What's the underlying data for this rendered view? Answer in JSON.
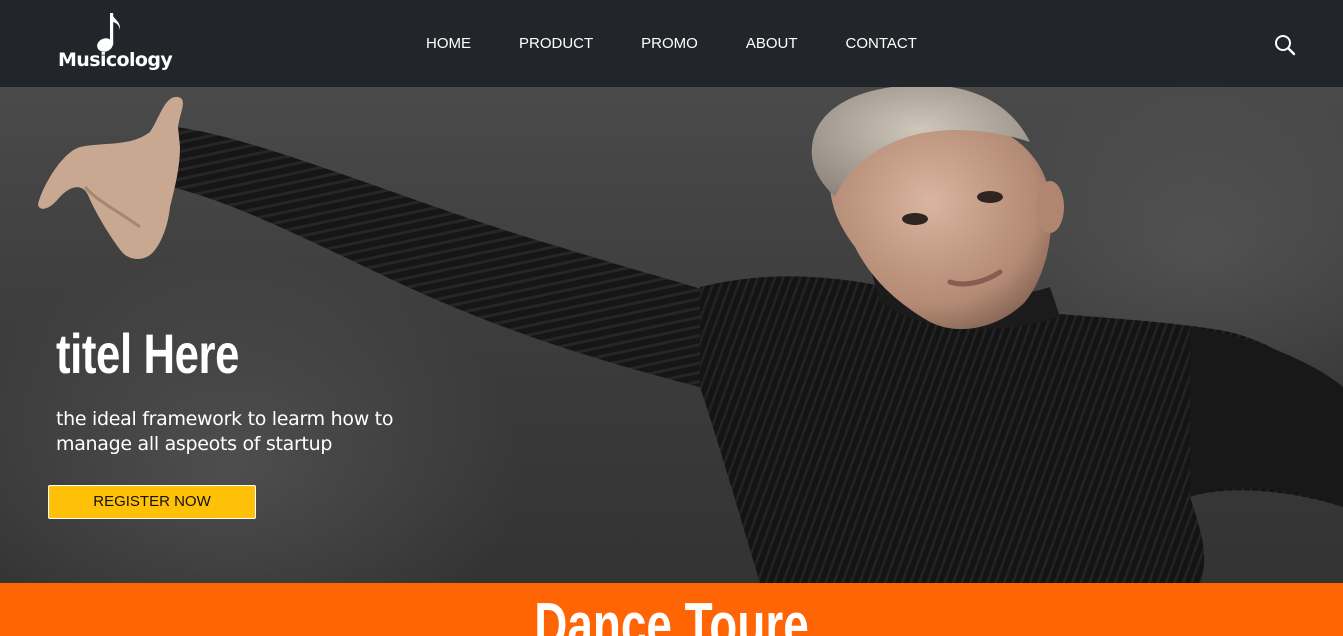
{
  "header": {
    "brand": "Musicology",
    "logo_icon": "music-note-icon",
    "nav": [
      {
        "label": "HOME"
      },
      {
        "label": "PRODUCT"
      },
      {
        "label": "PROMO"
      },
      {
        "label": "ABOUT"
      },
      {
        "label": "CONTACT"
      }
    ],
    "search_icon": "search-icon"
  },
  "hero": {
    "title": "titel Here",
    "subtitle": "the ideal framework to learm how to manage all aspeots of startup",
    "cta_label": "REGISTER NOW"
  },
  "section": {
    "title": "Dance Toure"
  },
  "colors": {
    "navbar_bg": "#22252a",
    "accent_yellow": "#ffc107",
    "accent_orange": "#ff6505",
    "text_white": "#ffffff"
  }
}
